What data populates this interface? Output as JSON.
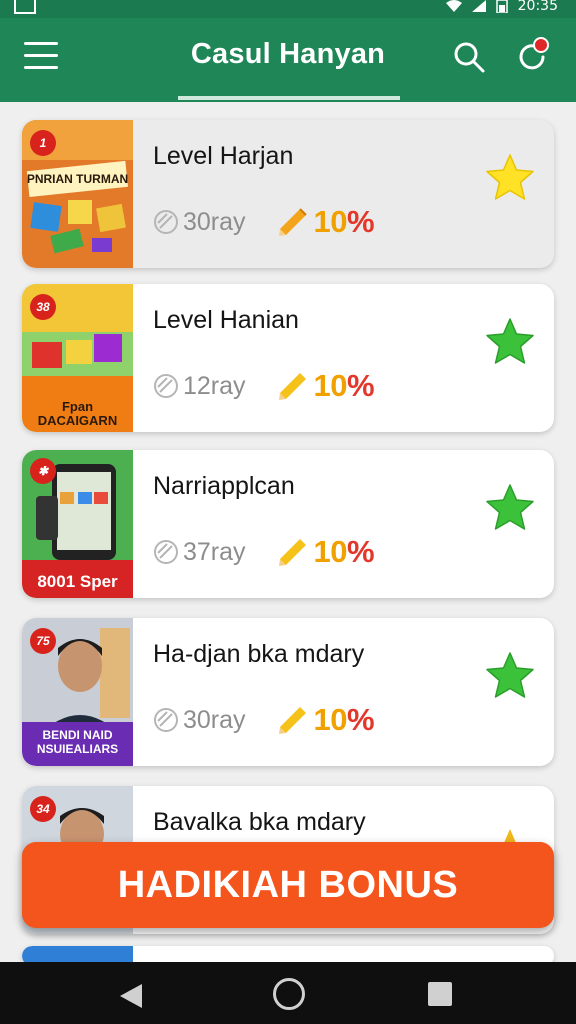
{
  "status_bar": {
    "time": "20:35"
  },
  "app_bar": {
    "title": "Casul Hanyan"
  },
  "items": [
    {
      "title": "Level Harjan",
      "count": "30ray",
      "percent": "10",
      "percent_sign": "%",
      "star_color": "#ffe126",
      "badge": "1",
      "thumb_text": "PNRIAN TURMAN",
      "thumb_bg": "#e37a2a",
      "label_bg": ""
    },
    {
      "title": "Level Hanian",
      "count": "12ray",
      "percent": "10",
      "percent_sign": "%",
      "star_color": "#3cc23a",
      "badge": "38",
      "thumb_text": "Fpan DACAIGARN",
      "thumb_bg": "#f28a1c",
      "label_bg": "#f07c14"
    },
    {
      "title": "Narriapplcan",
      "count": "37ray",
      "percent": "10",
      "percent_sign": "%",
      "star_color": "#3cc23a",
      "badge": "",
      "thumb_text": "8001 Sper",
      "thumb_bg": "#4caf50",
      "label_bg": "#d62424"
    },
    {
      "title": "Ha-djan bka mdary",
      "count": "30ray",
      "percent": "10",
      "percent_sign": "%",
      "star_color": "#3cc23a",
      "badge": "75",
      "thumb_text": "BENDI NAID NSUIEALIARS",
      "thumb_bg": "#c9ced6",
      "label_bg": "#6a2cb3"
    },
    {
      "title": "Bavalka bka mdary",
      "count": "",
      "percent": "",
      "percent_sign": "",
      "star_color": "#f1b81b",
      "badge": "34",
      "thumb_text": "",
      "thumb_bg": "#cfd6de",
      "label_bg": ""
    }
  ],
  "bonus_button": {
    "label": "HADIKIAH BONUS"
  },
  "colors": {
    "primary": "#1f8657",
    "accent": "#f4551c",
    "percent_orange": "#f0a100",
    "percent_red": "#e2372a"
  }
}
